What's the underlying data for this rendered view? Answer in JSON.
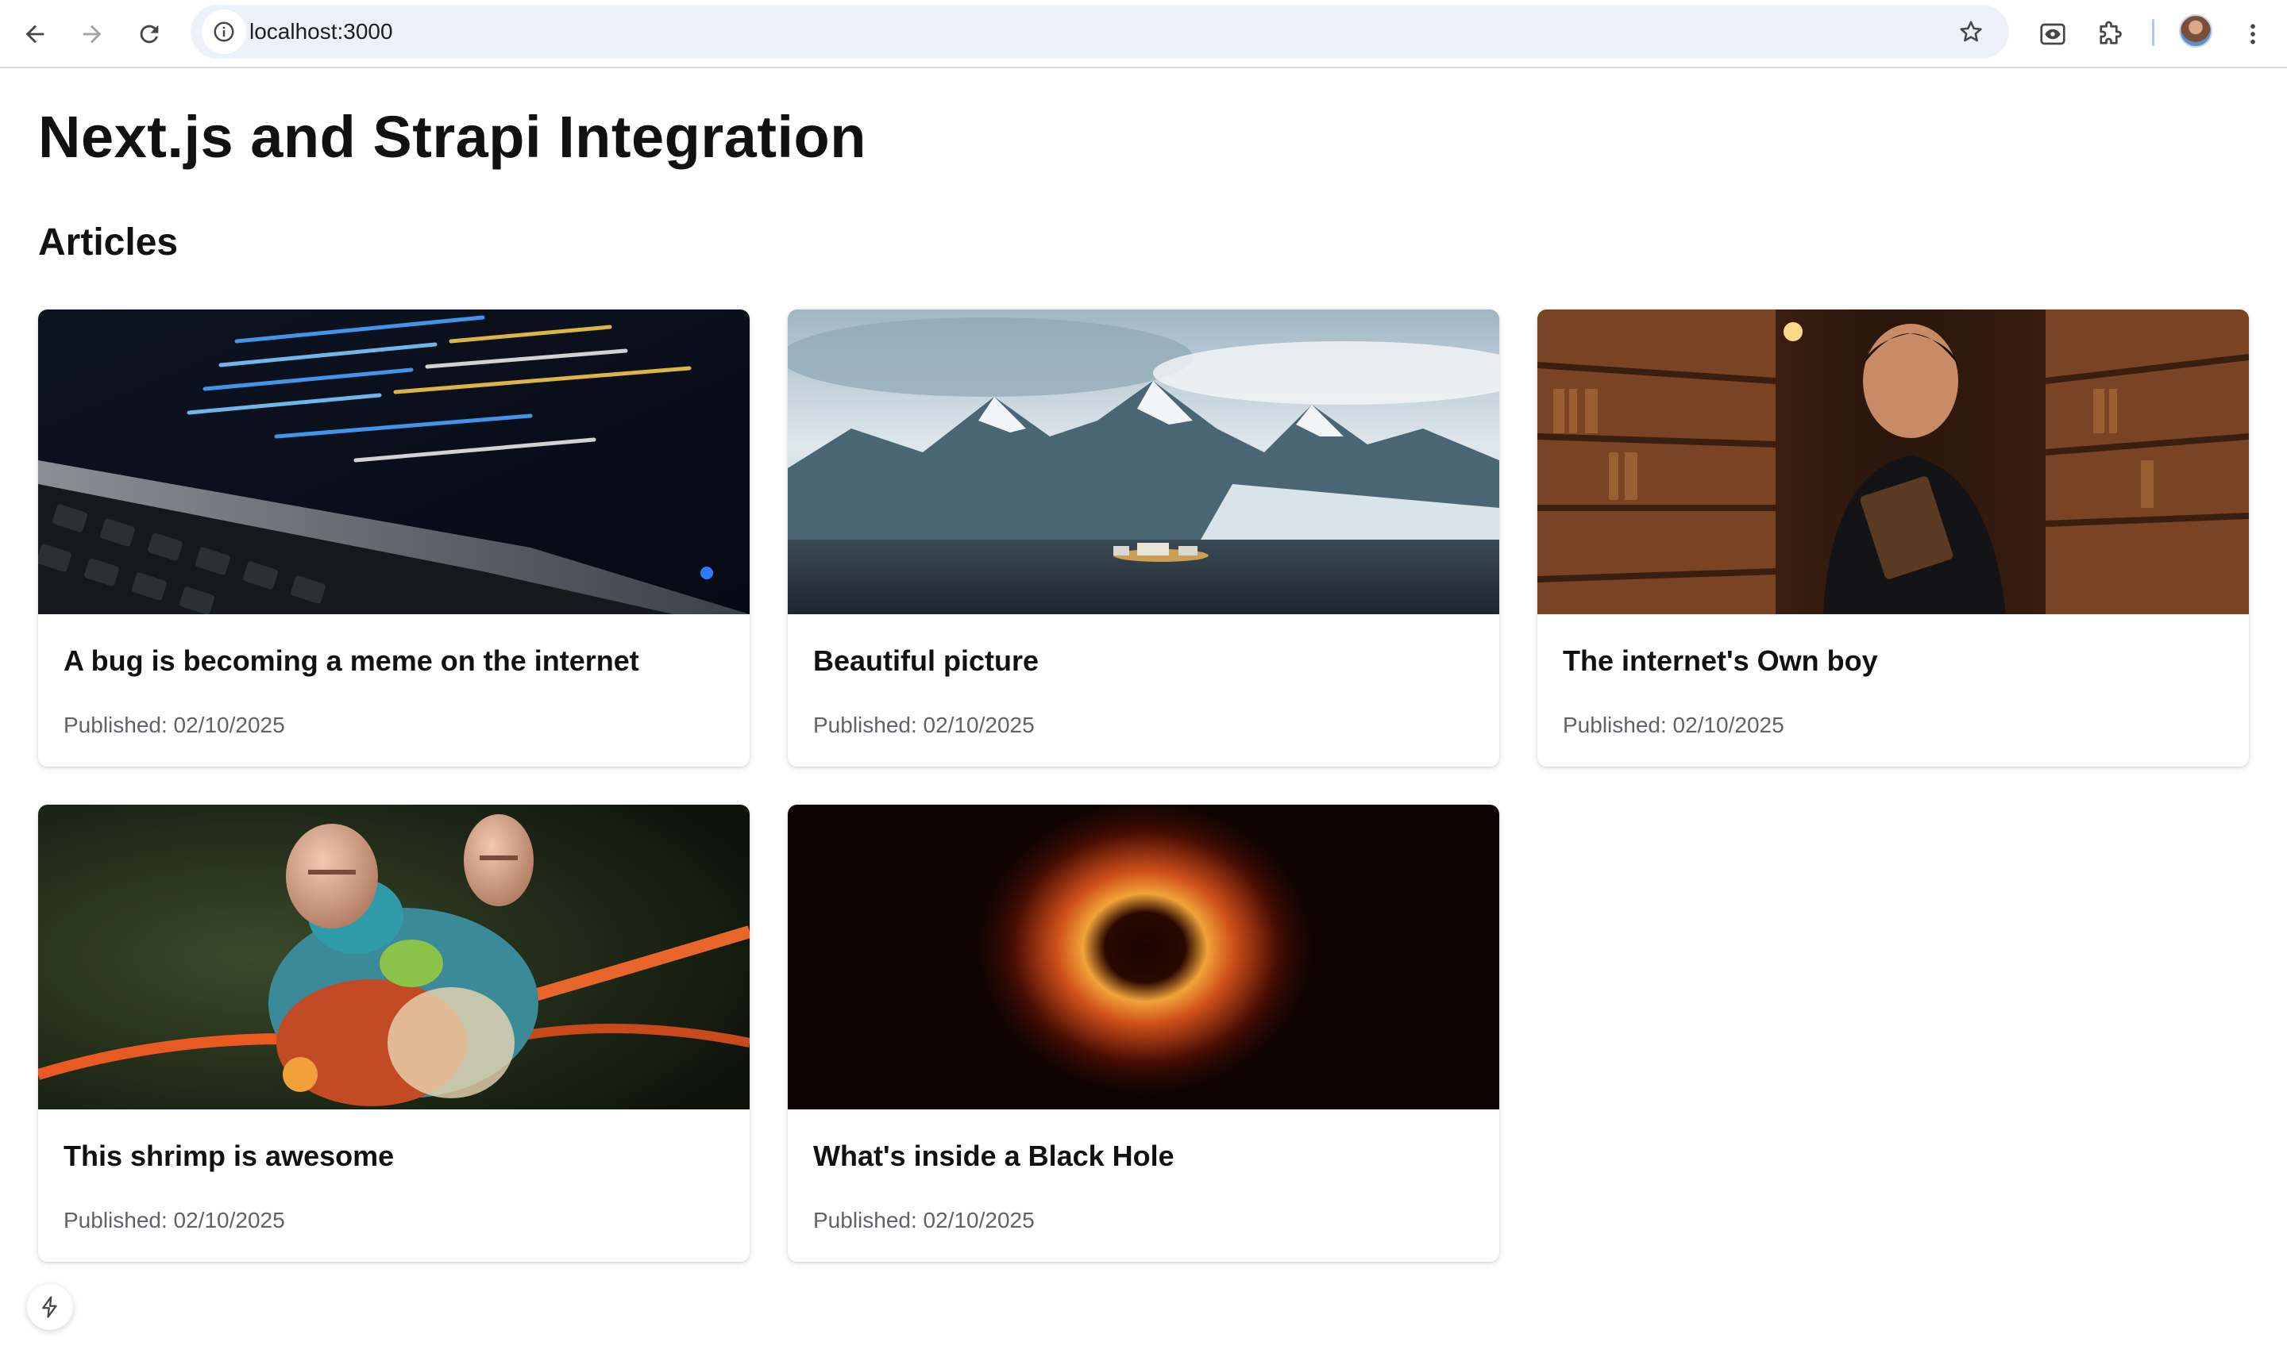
{
  "browser": {
    "url": "localhost:3000",
    "icons": [
      "back-arrow-icon",
      "forward-arrow-icon",
      "reload-icon",
      "site-info-icon",
      "bookmark-star-icon",
      "eye-extension-icon",
      "extensions-puzzle-icon",
      "profile-avatar",
      "more-vert-icon"
    ]
  },
  "page": {
    "title": "Next.js and Strapi Integration",
    "section_title": "Articles"
  },
  "articles": [
    {
      "title": "A bug is becoming a meme on the internet",
      "published": "Published: 02/10/2025",
      "image": "laptop-code"
    },
    {
      "title": "Beautiful picture",
      "published": "Published: 02/10/2025",
      "image": "snowy-mountains"
    },
    {
      "title": "The internet's Own boy",
      "published": "Published: 02/10/2025",
      "image": "library-portrait"
    },
    {
      "title": "This shrimp is awesome",
      "published": "Published: 02/10/2025",
      "image": "mantis-shrimp"
    },
    {
      "title": "What's inside a Black Hole",
      "published": "Published: 02/10/2025",
      "image": "black-hole"
    }
  ],
  "colors": {
    "omnibox_bg": "#edf2fa",
    "text_primary": "#111111",
    "text_meta": "#5f6368"
  }
}
